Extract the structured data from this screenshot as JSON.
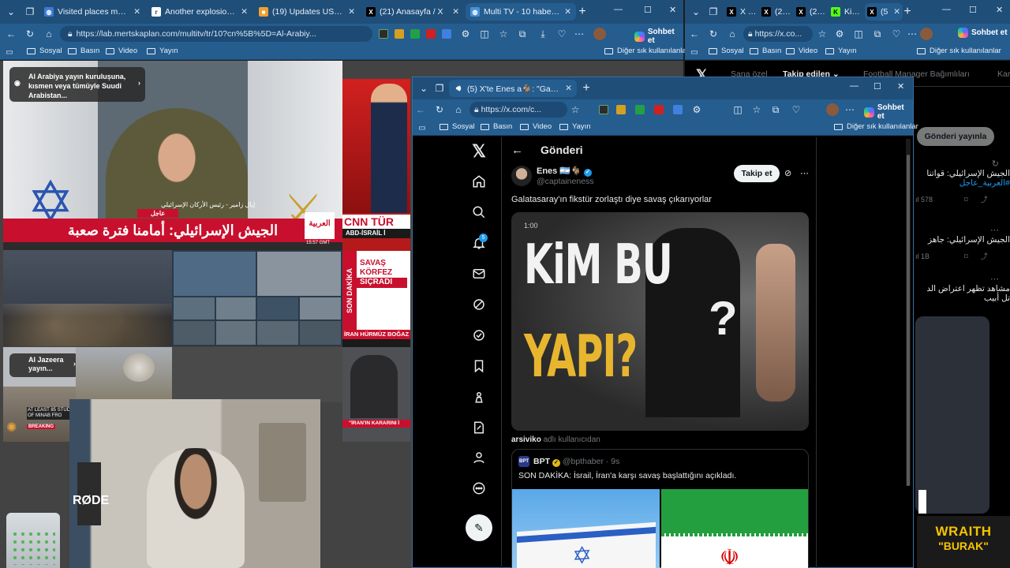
{
  "colors": {
    "chrome": "#1f4e79",
    "chrome_light": "#255d8f",
    "x_bg": "#000000",
    "x_text": "#e7e9ea",
    "x_muted": "#71767b",
    "verified": "#1d9bf0",
    "news_red": "#c8102e"
  },
  "main_window": {
    "tabs": [
      {
        "label": "Visited places map editor",
        "icon": "globe-icon"
      },
      {
        "label": "Another explosion sound a",
        "icon": "reddit-icon"
      },
      {
        "label": "(19) Updates US, Israel atta",
        "icon": "news-icon"
      },
      {
        "label": "(21) Anasayfa / X",
        "icon": "x-logo-icon"
      },
      {
        "label": "Multi TV - 10 haber ka",
        "icon": "globe-icon",
        "active": true
      }
    ],
    "url": "https://lab.mertskaplan.com/multitv/tr/10?cn%5B%5D=Al-Arabiy...",
    "copilot_label": "Sohbet et",
    "favorites": [
      "Sosyal",
      "Basın",
      "Video",
      "Yayın"
    ],
    "other_favorites": "Diğer sık kullanılanlar"
  },
  "right_window": {
    "tabs": [
      "X Kat",
      "(21) A",
      "(21) X",
      "KickP",
      "(5"
    ],
    "url": "https://x.co...",
    "copilot_label": "Sohbet et",
    "favorites": [
      "Sosyal",
      "Basın",
      "Video",
      "Yayın"
    ],
    "other_favorites": "Diğer sık kullanılanlar",
    "x_tabs": [
      "Sana özel",
      "Takip edilen",
      "Football Manager Bağımlıları",
      "Kar"
    ],
    "post_button": "Gönderi yayınla",
    "feed": [
      {
        "text": "الجيش الإسرائيلي: قواتنا",
        "hashtag": "#العربية_عاجل",
        "count": "578"
      },
      {
        "text": "الجيش الإسرائيلي: جاهز",
        "count": "1B"
      },
      {
        "text": "مشاهد تظهر اعتراض الد",
        "text2": "تل أبيب"
      }
    ]
  },
  "tv": {
    "alarabiya_caption": "Al Arabiya yayın kurulușuna, kısmen veya tümüyle Suudi Arabistan...",
    "alarabiya_headline": "الجيش الإسرائيلي: أمامنا فترة صعبة",
    "alarabiya_urgent": "عاجل",
    "alarabiya_speaker": "إيال زامير - رئيس الأركان الإسرائيلي",
    "alarabiya_logo": "العربية",
    "alarabiya_time": "15:57 GMT",
    "cnn_logo": "CNN TÜR",
    "cnn_ticker": "ABD-İSRAİL İ",
    "son_dakika": "SON DAKİKA",
    "savas_text": "SAVAŞ",
    "korfez_text": "KÖRFEZ",
    "sicradi_text": "SIÇRADI",
    "iran_text": "İRAN HÜRMÜZ BOĞAZ",
    "aljazeera_caption": "Al Jazeera yayın...",
    "iran_karar": "\"İRAN'IN KARARINI İ",
    "breaking": "BREAKING",
    "aj_ticker": "AT LEAST 85 STUDE CITY OF MINAB FRO",
    "rode": "RØDE",
    "streamer_name_1": "WRAITH",
    "streamer_name_2": "\"BURAK\""
  },
  "x_window": {
    "tab_label": "(5) X'te Enes a🐐: \"Galatasar",
    "url": "https://x.com/c...",
    "copilot_label": "Sohbet et",
    "favorites": [
      "Sosyal",
      "Basın",
      "Video",
      "Yayın"
    ],
    "other_favorites": "Diğer sık kullanılanlar",
    "header": "Gönderi",
    "notif_badge": "5",
    "author_name": "Enes 🇦🇷🐐",
    "author_handle": "@captaineness",
    "follow": "Takip et",
    "post_text": "Galatasaray'ın fikstür zorlaştı diye savaş çıkarıyorlar",
    "video_time": "1:00",
    "video_text_1": "KiM BU",
    "video_text_2": "YAPI?",
    "video_qmark": "?",
    "reposted_by": "arsiviko",
    "reposted_suffix": " adlı kullanıcıdan",
    "quote_name": "BPT",
    "quote_handle": "@bpthaber · 9s",
    "quote_text": "SON DAKİKA: İsrail, İran'a karşı savaş başlattığını açıkladı."
  }
}
